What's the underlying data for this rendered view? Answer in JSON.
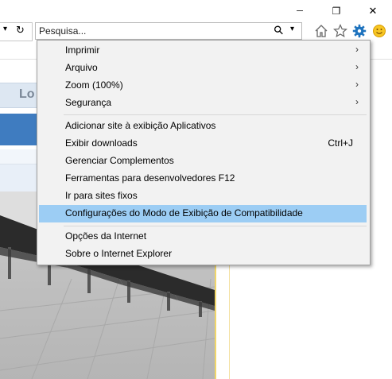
{
  "window": {
    "minimize_glyph": "─",
    "restore_glyph": "❐",
    "close_glyph": "✕"
  },
  "nav": {
    "refresh_glyph": "↻",
    "dropdown_glyph": "▾"
  },
  "search": {
    "placeholder": "Pesquisa...",
    "search_glyph": "⚲",
    "dropdown_glyph": "▾"
  },
  "toolbar": {
    "home_icon": "home-icon",
    "favorites_icon": "star-icon",
    "tools_icon": "gear-icon",
    "feedback_icon": "smiley-icon",
    "accent_color": "#1e73be"
  },
  "page": {
    "header_text": "Lo",
    "header_color": "#7a8797",
    "bar_color": "#3f7cc0"
  },
  "menu": {
    "group1": [
      {
        "label": "Imprimir",
        "submenu": true
      },
      {
        "label": "Arquivo",
        "submenu": true
      },
      {
        "label": "Zoom (100%)",
        "submenu": true
      },
      {
        "label": "Segurança",
        "submenu": true
      }
    ],
    "group2": [
      {
        "label": "Adicionar site à exibição Aplicativos",
        "shortcut": ""
      },
      {
        "label": "Exibir downloads",
        "shortcut": "Ctrl+J"
      },
      {
        "label": "Gerenciar Complementos",
        "shortcut": ""
      },
      {
        "label": "Ferramentas para desenvolvedores F12",
        "shortcut": ""
      },
      {
        "label": "Ir para sites fixos",
        "shortcut": ""
      },
      {
        "label": "Configurações do Modo de Exibição de Compatibilidade",
        "shortcut": "",
        "highlighted": true
      }
    ],
    "group3": [
      {
        "label": "Opções da Internet"
      },
      {
        "label": "Sobre o Internet Explorer"
      }
    ],
    "arrow_glyph": "›",
    "highlight_color": "#9ccdf4"
  }
}
